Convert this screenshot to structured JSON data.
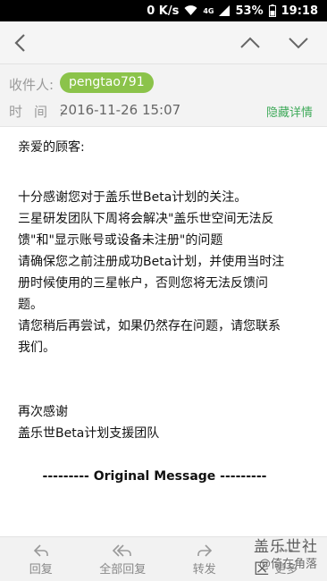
{
  "status_bar": {
    "net_speed": "0 K/s",
    "network_type": "4G",
    "battery": "53%",
    "time": "19:18"
  },
  "action_bar": {
    "icons": [
      "back-arrow-icon",
      "chevron-up-icon",
      "chevron-down-icon"
    ]
  },
  "header": {
    "recipient_label": "收件人:",
    "recipient": "pengtao791",
    "time_label": "时间:",
    "time_value": "2016-11-26 15:07",
    "hide_details": "隐藏详情"
  },
  "body": {
    "salutation": "亲爱的顾客:",
    "lines": [
      "十分感谢您对于盖乐世Beta计划的关注。",
      "三星研发团队下周将会解决\"盖乐世空间无法反",
      "馈\"和\"显示账号或设备未注册\"的问题",
      "请确保您之前注册成功Beta计划，并使用当时注",
      "册时候使用的三星帐户，否则您将无法反馈问",
      "题。",
      "请您稍后再尝试，如果仍然存在问题，请您联系",
      "我们。"
    ],
    "closing_1": "再次感谢",
    "closing_2": "盖乐世Beta计划支援团队",
    "original_message": "--------- Original Message ---------"
  },
  "bottom_bar": {
    "reply": "回复",
    "reply_all": "全部回复",
    "forward": "转发",
    "more": "更多"
  },
  "watermark": {
    "top": "盖乐世社区",
    "bottom": "@倚在角落"
  },
  "colors": {
    "chip": "#8bc34a",
    "link": "#3faa5a"
  }
}
